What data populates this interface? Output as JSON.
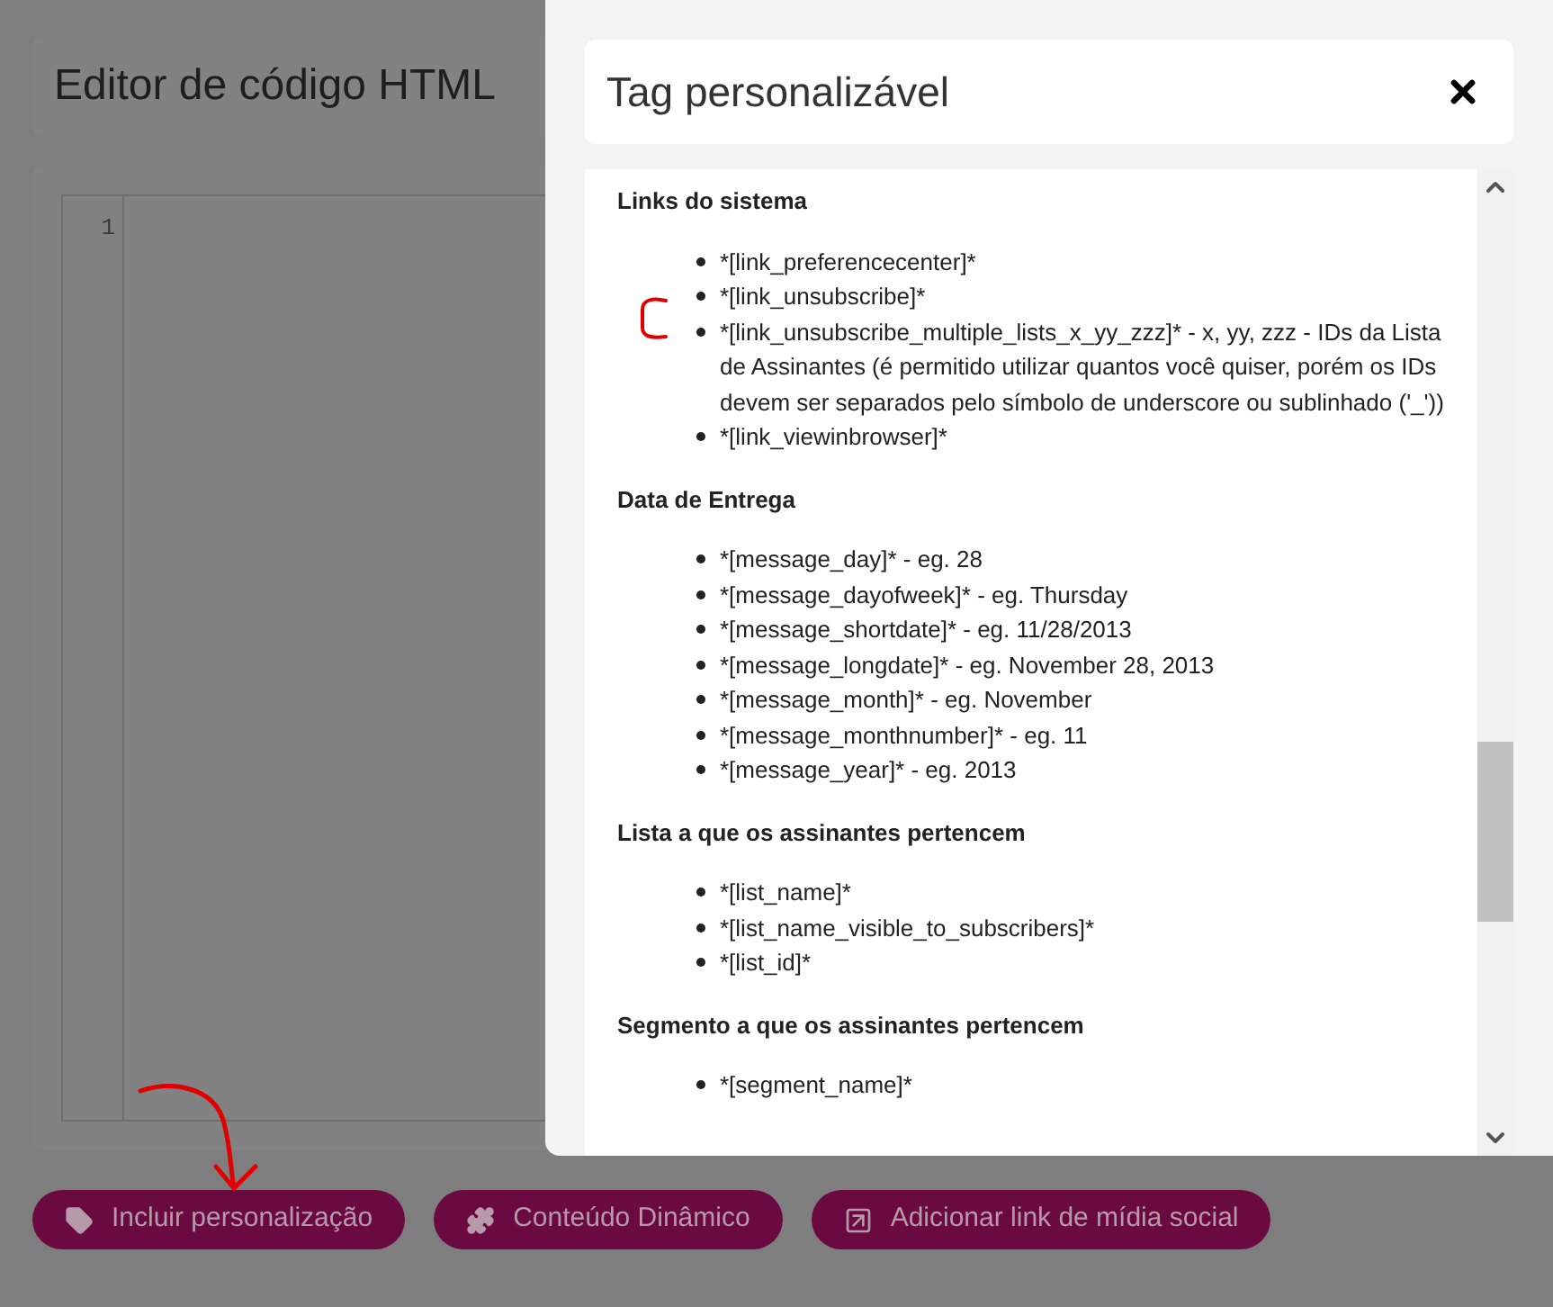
{
  "page": {
    "title": "Editor de código HTML",
    "editor": {
      "line_numbers": [
        "1"
      ]
    },
    "buttons": [
      {
        "label": "Incluir personalização",
        "kind": "tag"
      },
      {
        "label": "Conteúdo Dinâmico",
        "kind": "puzzle"
      },
      {
        "label": "Adicionar link de mídia social",
        "kind": "link"
      }
    ]
  },
  "modal": {
    "title": "Tag personalizável",
    "sections": [
      {
        "heading": "Links do sistema",
        "items": [
          "*[link_preferencecenter]*",
          "*[link_unsubscribe]*",
          "*[link_unsubscribe_multiple_lists_x_yy_zzz]* - x, yy, zzz - IDs da Lista de Assinantes (é permitido utilizar quantos você quiser, porém os IDs devem ser separados pelo símbolo de underscore ou sublinhado ('_'))",
          "*[link_viewinbrowser]*"
        ]
      },
      {
        "heading": "Data de Entrega",
        "items": [
          "*[message_day]* - eg. 28",
          "*[message_dayofweek]* - eg. Thursday",
          "*[message_shortdate]* - eg. 11/28/2013",
          "*[message_longdate]* - eg. November 28, 2013",
          "*[message_month]* - eg. November",
          "*[message_monthnumber]* - eg. 11",
          "*[message_year]* - eg. 2013"
        ]
      },
      {
        "heading": "Lista a que os assinantes pertencem",
        "items": [
          "*[list_name]*",
          "*[list_name_visible_to_subscribers]*",
          "*[list_id]*"
        ]
      },
      {
        "heading": "Segmento a que os assinantes pertencem",
        "items": [
          "*[segment_name]*"
        ]
      }
    ]
  }
}
